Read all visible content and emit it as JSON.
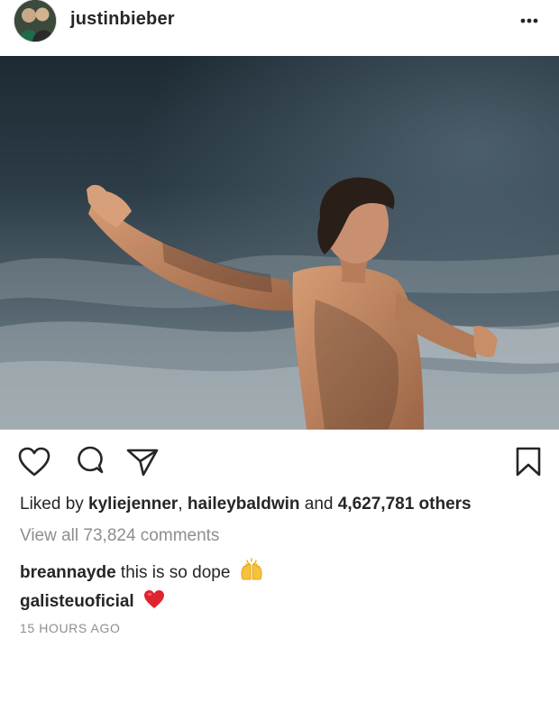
{
  "post": {
    "username": "justinbieber",
    "liked_prefix": "Liked by ",
    "liked_user_1": "kyliejenner",
    "liked_sep": ", ",
    "liked_user_2": "haileybaldwin",
    "liked_and": " and ",
    "liked_count": "4,627,781 others",
    "view_comments": "View all 73,824 comments",
    "comments": [
      {
        "user": "breannayde",
        "text": " this is so dope",
        "emoji": "raising-hands"
      },
      {
        "user": "galisteuoficial",
        "text": "",
        "emoji": "red-heart"
      }
    ],
    "timestamp": "15 HOURS AGO"
  },
  "icons": {
    "more": "more-options-icon",
    "like": "heart-icon",
    "comment": "comment-icon",
    "share": "share-icon",
    "save": "bookmark-icon"
  },
  "colors": {
    "text": "#262626",
    "muted": "#8e8e8e",
    "heart_emoji": "#e0242f",
    "hands_emoji": "#f4b400"
  }
}
